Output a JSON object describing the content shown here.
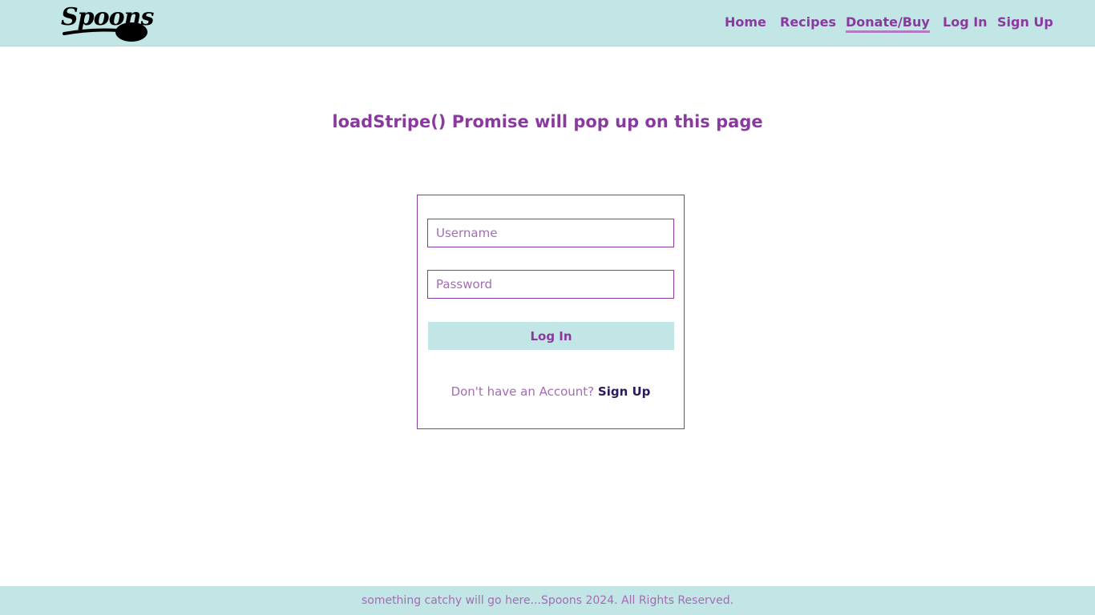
{
  "brand": {
    "logo_text": "Spoons"
  },
  "nav": {
    "items": [
      {
        "label": "Home"
      },
      {
        "label": "Recipes"
      },
      {
        "label": "Donate/Buy",
        "active": true
      },
      {
        "label": "Log In"
      },
      {
        "label": "Sign Up"
      }
    ]
  },
  "main": {
    "heading": "loadStripe() Promise will pop up on this page"
  },
  "login_form": {
    "username_placeholder": "Username",
    "password_placeholder": "Password",
    "username_value": "",
    "password_value": "",
    "submit_label": "Log In",
    "signup_prompt": "Don't have an Account?",
    "signup_link": "Sign Up"
  },
  "footer": {
    "text": "something catchy will go here...Spoons 2024. All Rights Reserved."
  },
  "colors": {
    "header_bg": "#c2e5e5",
    "accent_purple": "#8a3a9e",
    "light_purple": "#a46db3",
    "link_dark": "#2c1a5c"
  }
}
